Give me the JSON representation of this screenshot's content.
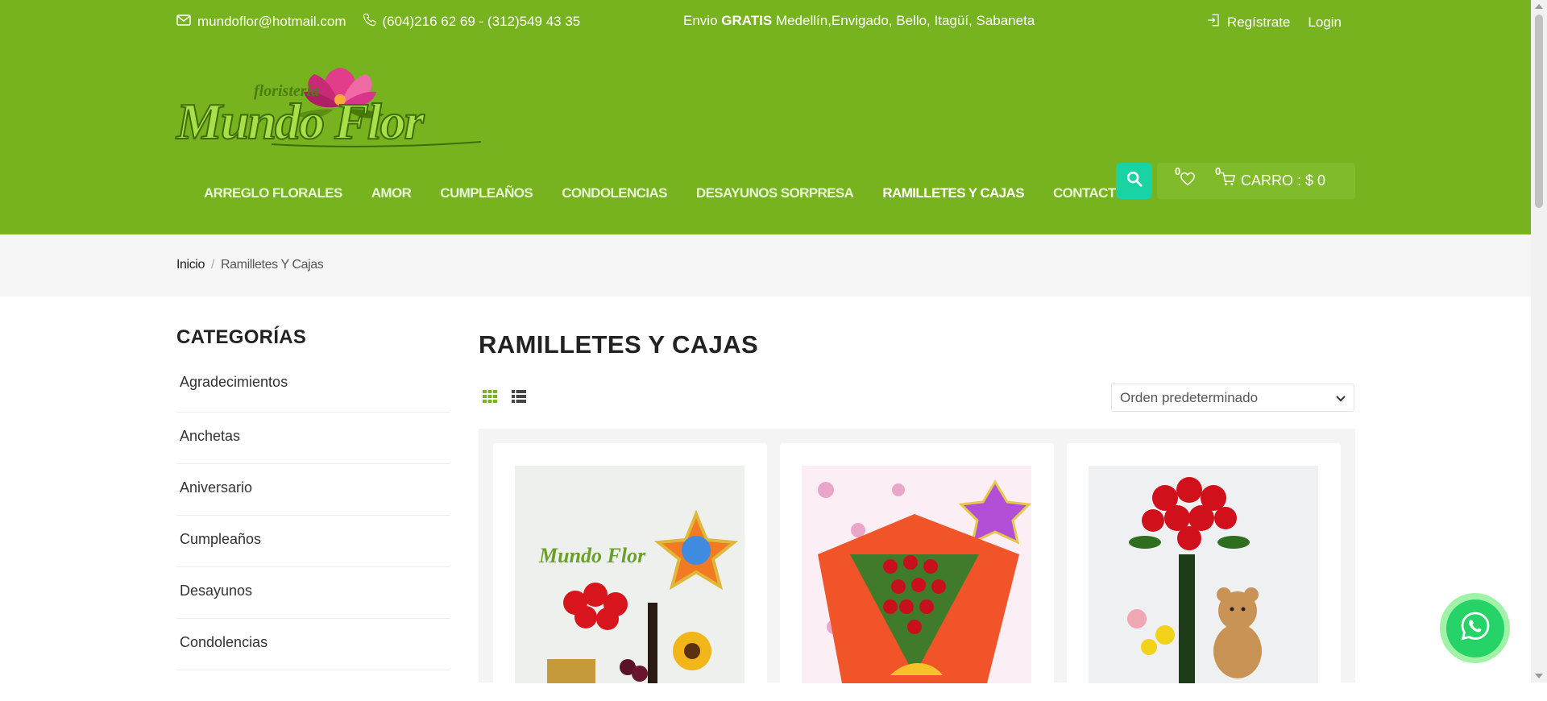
{
  "topbar": {
    "email": "mundoflor@hotmail.com",
    "phone": "(604)216 62 69 - (312)549 43 35",
    "shipping_prefix": "Envio ",
    "shipping_bold": "GRATIS",
    "shipping_suffix": " Medellín,Envigado, Bello, Itagüí, Sabaneta",
    "register": "Regístrate",
    "login": "Login"
  },
  "logo": {
    "small_text": "floristeria",
    "main_text": "Mundo Flor"
  },
  "nav": {
    "items": [
      {
        "label": "ARREGLO FLORALES"
      },
      {
        "label": "AMOR"
      },
      {
        "label": "CUMPLEAÑOS"
      },
      {
        "label": "CONDOLENCIAS"
      },
      {
        "label": "DESAYUNOS SORPRESA"
      },
      {
        "label": "RAMILLETES Y CAJAS"
      },
      {
        "label": "CONTACTO"
      }
    ]
  },
  "cart": {
    "wishlist_count": "0",
    "cart_count": "0",
    "label": "CARRO : $ 0"
  },
  "breadcrumb": {
    "home": "Inicio",
    "separator": "/",
    "current": "Ramilletes Y Cajas"
  },
  "sidebar": {
    "title": "CATEGORÍAS",
    "items": [
      {
        "label": "Agradecimientos"
      },
      {
        "label": "Anchetas"
      },
      {
        "label": "Aniversario"
      },
      {
        "label": "Cumpleaños"
      },
      {
        "label": "Desayunos"
      },
      {
        "label": "Condolencias"
      }
    ]
  },
  "main": {
    "title": "RAMILLETES Y CAJAS",
    "sort_selected": "Orden predeterminado"
  },
  "colors": {
    "brand_green": "#76b31e",
    "accent_teal": "#19d3a4",
    "whatsapp_green": "#25d366"
  }
}
